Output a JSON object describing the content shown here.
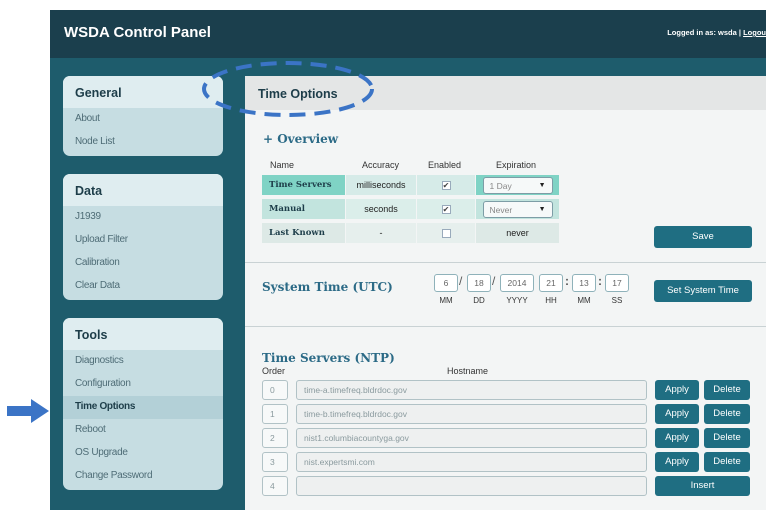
{
  "header": {
    "title": "WSDA Control Panel",
    "logged_in_text": "Logged in as: wsda | ",
    "logout_text": "Logou"
  },
  "sidebar": {
    "general": {
      "heading": "General",
      "items": [
        {
          "label": "About"
        },
        {
          "label": "Node List"
        }
      ]
    },
    "data": {
      "heading": "Data",
      "items": [
        {
          "label": "J1939"
        },
        {
          "label": "Upload Filter"
        },
        {
          "label": "Calibration"
        },
        {
          "label": "Clear Data"
        }
      ]
    },
    "tools": {
      "heading": "Tools",
      "items": [
        {
          "label": "Diagnostics"
        },
        {
          "label": "Configuration"
        },
        {
          "label": "Time Options",
          "active": true
        },
        {
          "label": "Reboot"
        },
        {
          "label": "OS Upgrade"
        },
        {
          "label": "Change Password"
        }
      ]
    }
  },
  "main": {
    "title": "Time Options",
    "overview": {
      "title": "+ Overview",
      "columns": [
        "Name",
        "Accuracy",
        "Enabled",
        "Expiration"
      ],
      "rows": [
        {
          "name": "Time Servers",
          "accuracy": "milliseconds",
          "enabled": true,
          "expiration": "1 Day"
        },
        {
          "name": "Manual",
          "accuracy": "seconds",
          "enabled": true,
          "expiration": "Never"
        },
        {
          "name": "Last Known",
          "accuracy": "-",
          "enabled": false,
          "expiration": "never"
        }
      ],
      "save_label": "Save"
    },
    "system_time": {
      "title": "System Time (UTC)",
      "month": "6",
      "day": "18",
      "year": "2014",
      "hour": "21",
      "minute": "13",
      "second": "17",
      "labels": {
        "mm": "MM",
        "dd": "DD",
        "yyyy": "YYYY",
        "hh": "HH",
        "min": "MM",
        "ss": "SS"
      },
      "set_label": "Set System Time"
    },
    "ntp": {
      "title": "Time Servers (NTP)",
      "order_header": "Order",
      "hostname_header": "Hostname",
      "servers": [
        {
          "order": "0",
          "hostname": "time-a.timefreq.bldrdoc.gov"
        },
        {
          "order": "1",
          "hostname": "time-b.timefreq.bldrdoc.gov"
        },
        {
          "order": "2",
          "hostname": "nist1.columbiacountyga.gov"
        },
        {
          "order": "3",
          "hostname": "nist.expertsmi.com"
        }
      ],
      "new_order": "4",
      "new_hostname": "",
      "apply_label": "Apply",
      "delete_label": "Delete",
      "insert_label": "Insert"
    }
  },
  "colors": {
    "header_bg": "#1b3f4d",
    "frame_bg": "#1e5c6c",
    "accent_button": "#1f6e82",
    "highlight_row": "#7fd3c5",
    "annotation_blue": "#3b74c6"
  },
  "annotations": {
    "arrow_icon": "arrow-right-icon",
    "ellipse": "dashed-ellipse-highlight"
  }
}
